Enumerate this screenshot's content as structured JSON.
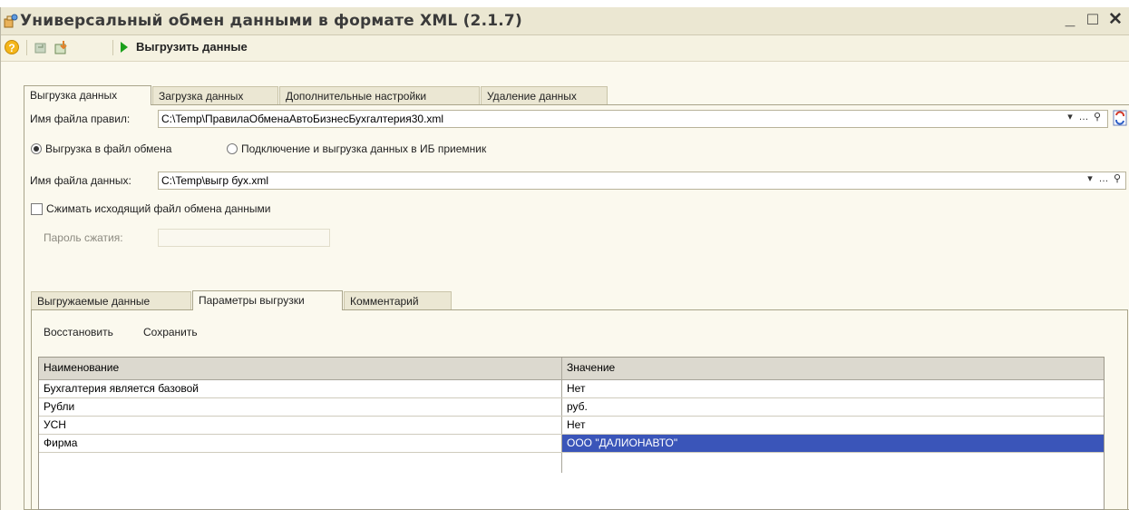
{
  "window": {
    "title": "Универсальный обмен данными в формате XML (2.1.7)",
    "controls": {
      "minimize": "_",
      "maximize": "□",
      "close": "✕"
    }
  },
  "toolbar": {
    "help": "?",
    "run_label": "Выгрузить данные"
  },
  "tabs": [
    "Выгрузка данных",
    "Загрузка данных",
    "Дополнительные настройки",
    "Удаление данных"
  ],
  "export": {
    "rules_label": "Имя файла правил:",
    "rules_value": "C:\\Temp\\ПравилаОбменаАвтоБизнесБухгалтерия30.xml",
    "radio_file": "Выгрузка в файл обмена",
    "radio_ib": "Подключение и выгрузка данных в ИБ приемник",
    "data_label": "Имя файла данных:",
    "data_value": "C:\\Temp\\выгр бух.xml",
    "compress_label": "Сжимать исходящий файл обмена данными",
    "password_label": "Пароль сжатия:",
    "password_value": ""
  },
  "subtabs": [
    "Выгружаемые данные",
    "Параметры выгрузки",
    "Комментарий"
  ],
  "params": {
    "restore": "Восстановить",
    "save": "Сохранить",
    "columns": [
      "Наименование",
      "Значение"
    ],
    "rows": [
      {
        "name": "Бухгалтерия является базовой",
        "value": "Нет"
      },
      {
        "name": "Рубли",
        "value": "руб."
      },
      {
        "name": "УСН",
        "value": "Нет"
      },
      {
        "name": "Фирма",
        "value": "ООО \"ДАЛИОНАВТО\""
      }
    ],
    "selected_row": 3
  },
  "colors": {
    "selection": "#3a55b9",
    "run_arrow": "#1ba01b"
  }
}
